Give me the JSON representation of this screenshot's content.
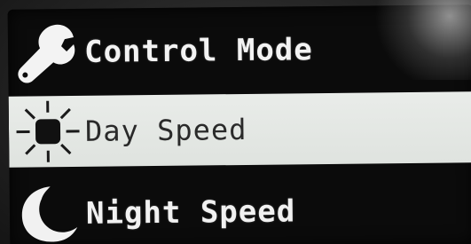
{
  "menu": {
    "items": [
      {
        "label": "Control Mode",
        "icon": "wrench-icon",
        "selected": false
      },
      {
        "label": "Day Speed",
        "icon": "sun-icon",
        "selected": true
      },
      {
        "label": "Night Speed",
        "icon": "moon-icon",
        "selected": false
      }
    ]
  },
  "colors": {
    "screen_background": "#0b0b0b",
    "text_normal": "#f3f3f3",
    "highlight_background": "#e5e8e5",
    "highlight_text": "#2a2a2a"
  }
}
